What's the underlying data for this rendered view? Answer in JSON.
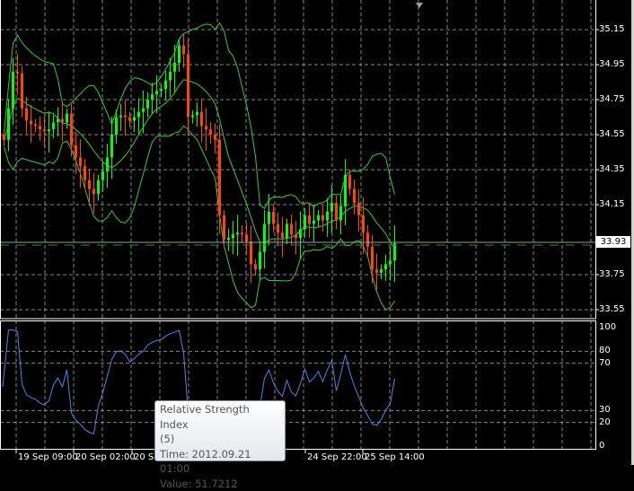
{
  "colors": {
    "bull": "#00ff00",
    "bear": "#ff4500",
    "bands": "#32cd32",
    "rsi": "#4a86e8",
    "grid": "#b0b0b0",
    "axis": "#ffffff"
  },
  "price_axis": {
    "labels": [
      "35.15",
      "34.95",
      "34.75",
      "34.55",
      "34.35",
      "34.15",
      "33.75",
      "33.55"
    ],
    "current_price": "33.93"
  },
  "rsi_axis": {
    "labels": [
      "100",
      "80",
      "70",
      "30",
      "20",
      "0"
    ]
  },
  "time_axis": {
    "labels": [
      "00",
      "19 Sep 09:00",
      "20 Sep 02:00",
      "20 Se",
      "00",
      "24 Sep 22:00",
      "25 Sep 14:00"
    ]
  },
  "tooltip": {
    "title": "Relative Strength Index",
    "params": "(5)",
    "time": "Time: 2012.09.21 01:00",
    "value": "Value: 51.7212"
  },
  "chart_data": {
    "type": "candlestick",
    "indicators": [
      "Bollinger Bands",
      "Relative Strength Index (5)"
    ],
    "closes": [
      34.52,
      34.7,
      34.91,
      34.9,
      34.7,
      34.63,
      34.61,
      34.6,
      34.58,
      34.57,
      34.58,
      34.62,
      34.64,
      34.62,
      34.67,
      34.49,
      34.42,
      34.37,
      34.29,
      34.24,
      34.21,
      34.29,
      34.34,
      34.42,
      34.55,
      34.65,
      34.66,
      34.65,
      34.63,
      34.65,
      34.68,
      34.7,
      34.75,
      34.78,
      34.8,
      34.81,
      34.86,
      34.91,
      34.96,
      35.06,
      35.01,
      34.65,
      34.66,
      34.68,
      34.6,
      34.58,
      34.55,
      34.52,
      34.09,
      33.95,
      33.96,
      33.98,
      33.99,
      33.98,
      33.94,
      33.81,
      33.78,
      33.88,
      34.04,
      34.11,
      34.04,
      33.99,
      33.96,
      34.04,
      33.98,
      33.96,
      34.01,
      34.09,
      34.04,
      34.06,
      34.09,
      34.06,
      34.11,
      34.16,
      34.06,
      34.14,
      34.32,
      34.24,
      34.16,
      34.09,
      33.99,
      33.91,
      33.78,
      33.76,
      33.78,
      33.81,
      33.83,
      33.93
    ]
  }
}
